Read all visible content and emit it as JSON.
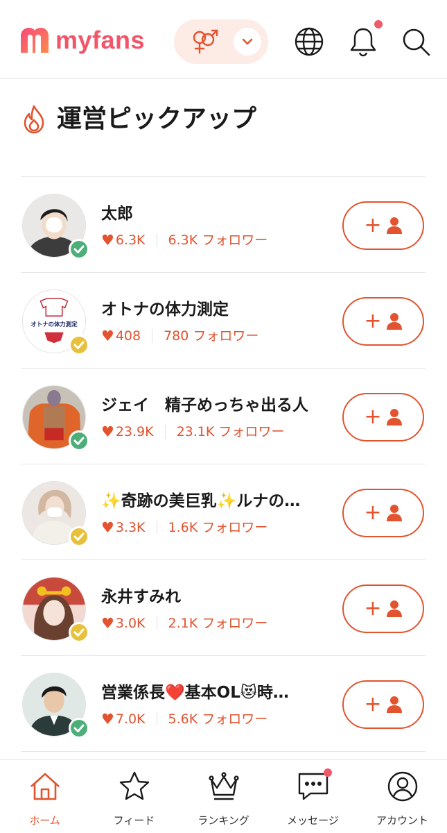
{
  "header": {
    "logo_text": "myfans",
    "brand_color": "#f2556a",
    "accent_color": "#e2532f",
    "gender_filter_icon": "gender-symbols-icon",
    "icons": [
      "globe-icon",
      "bell-icon",
      "search-icon"
    ],
    "notification_dot": true
  },
  "section": {
    "title": "運営ピックアップ",
    "icon": "flame-icon"
  },
  "creators": [
    {
      "name": "太郎",
      "likes": "6.3K",
      "followers": "6.3K",
      "follower_suffix": "フォロワー",
      "badge": "green"
    },
    {
      "name": "オトナの体力測定",
      "likes": "408",
      "followers": "780",
      "follower_suffix": "フォロワー",
      "badge": "gold",
      "avatar_text": "オトナの体力測定"
    },
    {
      "name": "ジェイ　精子めっちゃ出る人",
      "likes": "23.9K",
      "followers": "23.1K",
      "follower_suffix": "フォロワー",
      "badge": "green"
    },
    {
      "name": "✨奇跡の美巨乳✨ルナの…",
      "likes": "3.3K",
      "followers": "1.6K",
      "follower_suffix": "フォロワー",
      "badge": "gold"
    },
    {
      "name": "永井すみれ",
      "likes": "3.0K",
      "followers": "2.1K",
      "follower_suffix": "フォロワー",
      "badge": "gold"
    },
    {
      "name": "営業係長❤️基本OL😻時…",
      "likes": "7.0K",
      "followers": "5.6K",
      "follower_suffix": "フォロワー",
      "badge": "green"
    }
  ],
  "follow_button": {
    "plus": "+",
    "icon": "add-user-icon"
  },
  "bottom_nav": [
    {
      "label": "ホーム",
      "icon": "home-icon",
      "active": true
    },
    {
      "label": "フィード",
      "icon": "star-icon",
      "active": false
    },
    {
      "label": "ランキング",
      "icon": "crown-icon",
      "active": false
    },
    {
      "label": "メッセージ",
      "icon": "chat-icon",
      "active": false,
      "notification_dot": true
    },
    {
      "label": "アカウント",
      "icon": "account-icon",
      "active": false
    }
  ]
}
